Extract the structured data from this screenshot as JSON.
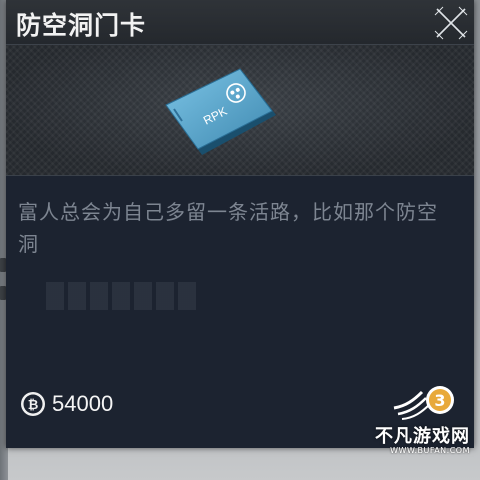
{
  "item_panel": {
    "title": "防空洞门卡",
    "card_print": "RPK",
    "description": "富人总会为自己多留一条活路，比如那个防空洞",
    "price": {
      "currency_icon": "bitcoin-coin-icon",
      "value": "54000"
    },
    "close_icon": "close-x-icon"
  },
  "watermark": {
    "name": "不凡游戏网",
    "url": "WWW.BUFAN.COM"
  },
  "colors": {
    "panel_bg": "#1c2330",
    "header_bg": "#2a2e33",
    "title_text": "#f2f2f2",
    "description_text": "#7d8591",
    "card_blue": "#5aa6cc",
    "price_text": "#f5f5f5"
  }
}
